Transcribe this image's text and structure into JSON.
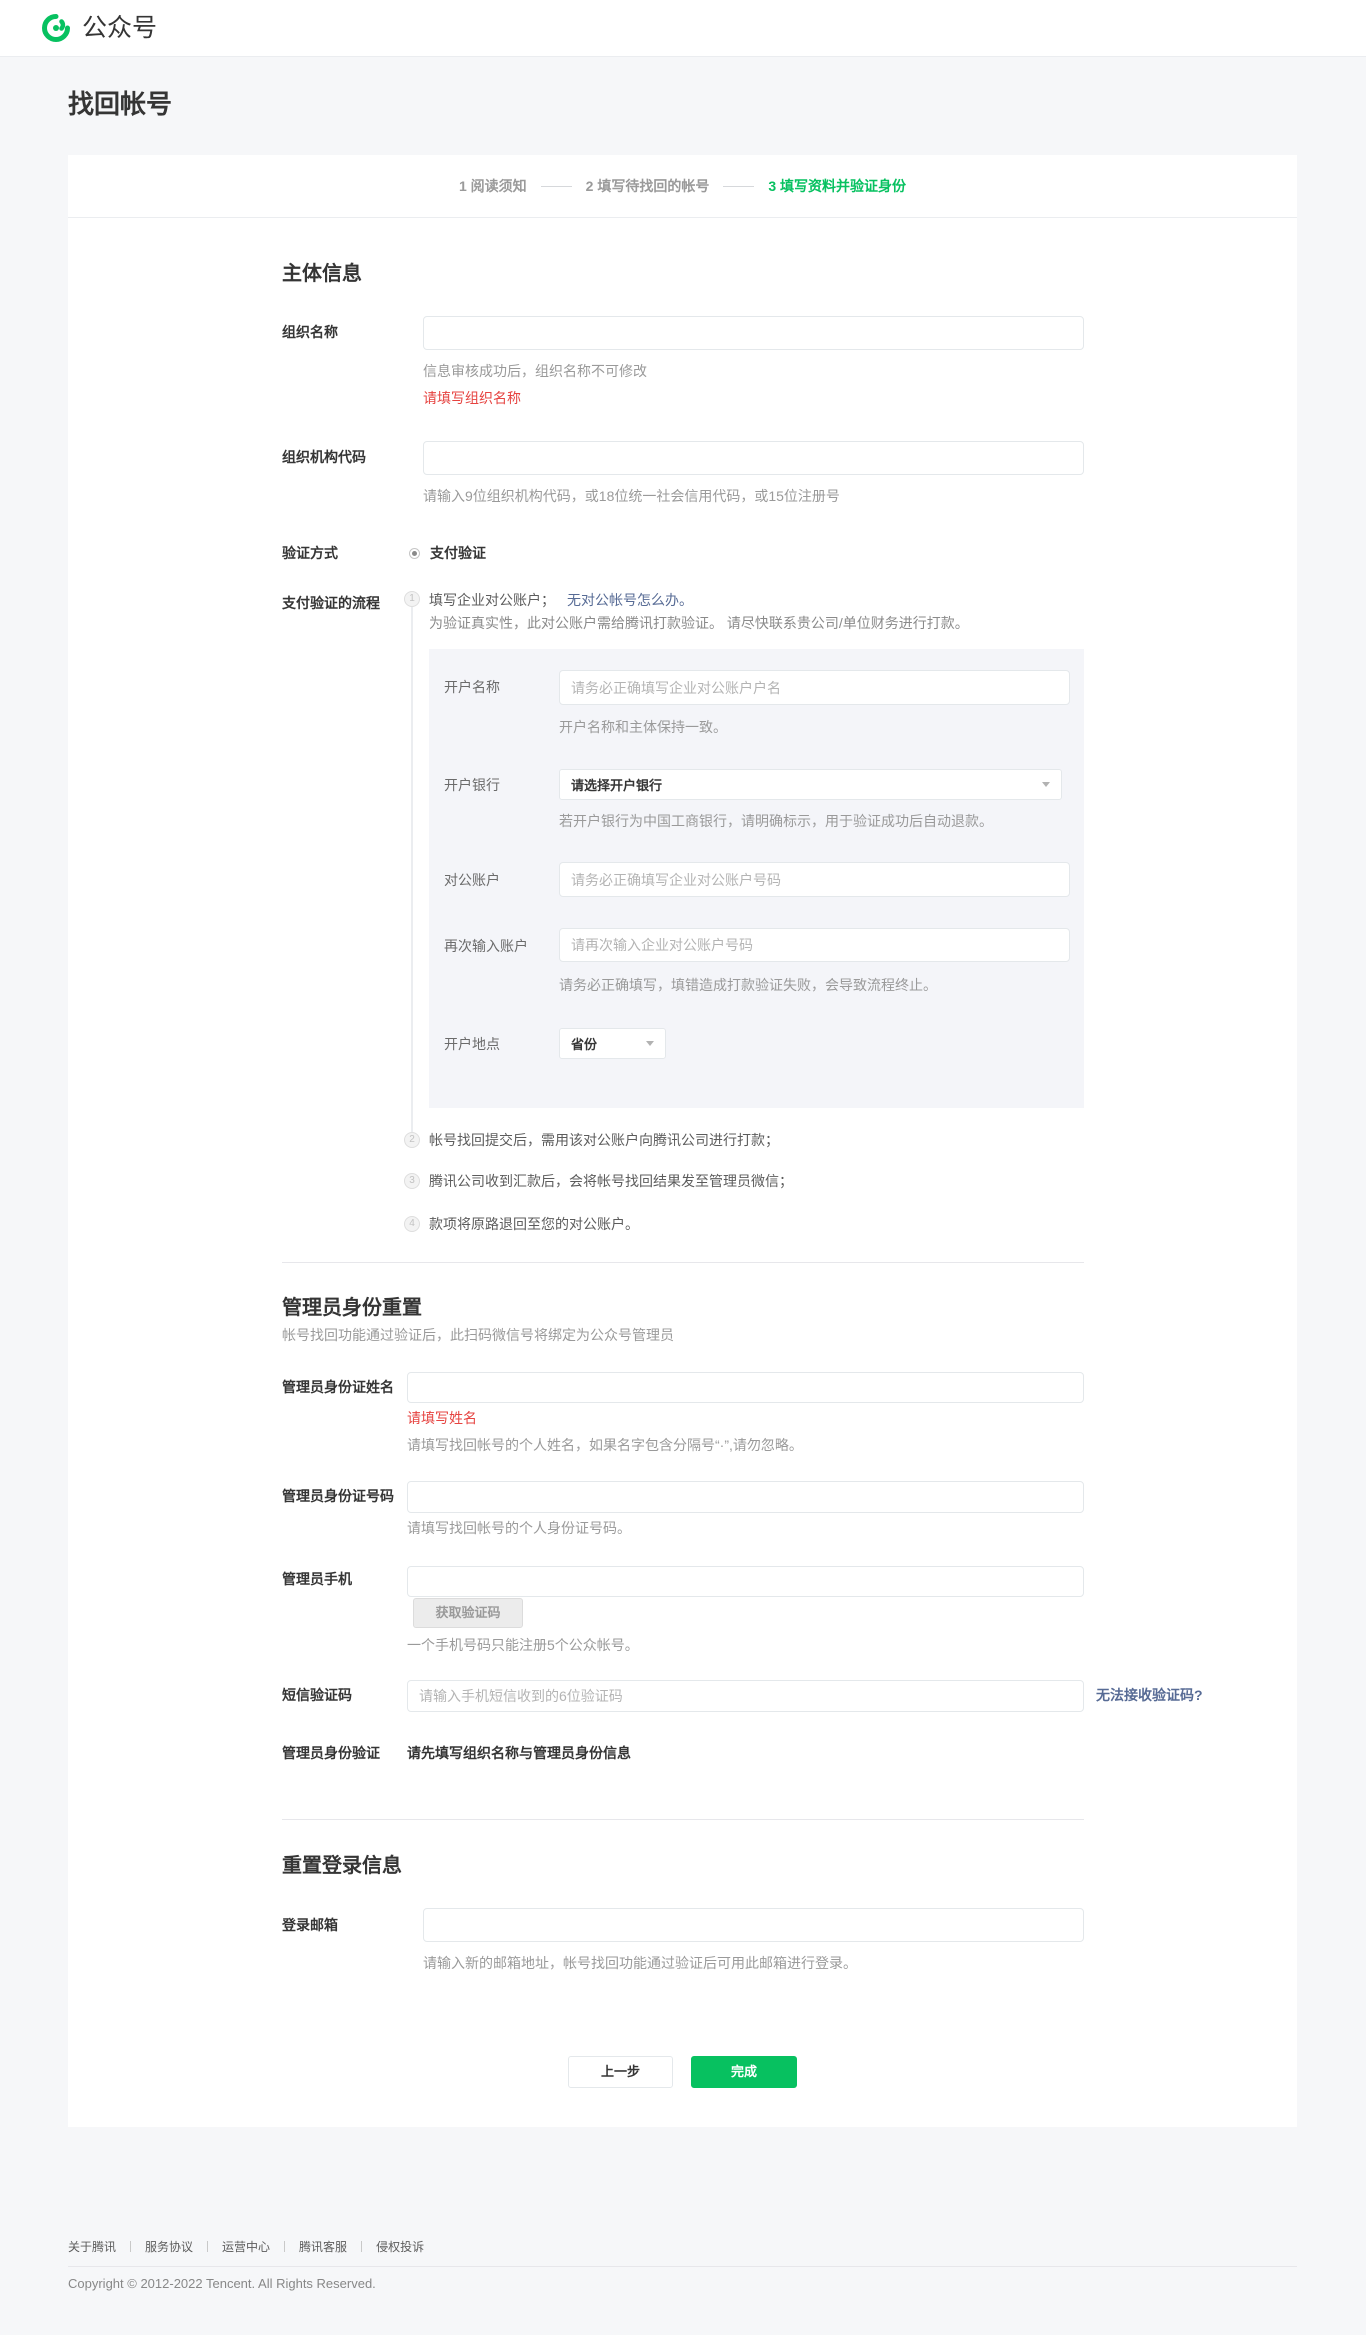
{
  "theme": {
    "accent": "#07c160",
    "link": "#576b95",
    "error": "#e64340"
  },
  "icons": {
    "logo": "official-account-logo-icon",
    "select_caret": "chevron-down-icon",
    "radio": "radio-selected-icon",
    "step_marker": "step-number-circle-icon"
  },
  "header": {
    "logo_text": "公众号"
  },
  "page_title": "找回帐号",
  "current_step": 3,
  "steps": [
    {
      "label": "1 阅读须知"
    },
    {
      "label": "2 填写待找回的帐号"
    },
    {
      "label": "3 填写资料并验证身份"
    }
  ],
  "subject": {
    "title": "主体信息",
    "org_name": {
      "label": "组织名称",
      "hint": "信息审核成功后，组织名称不可修改",
      "error": "请填写组织名称"
    },
    "org_code": {
      "label": "组织机构代码",
      "hint": "请输入9位组织机构代码，或18位统一社会信用代码，或15位注册号"
    },
    "verify_method": {
      "label": "验证方式",
      "option": "支付验证",
      "selected": true
    },
    "pay_flow": {
      "label": "支付验证的流程",
      "steps": [
        {
          "num": "1",
          "text": "填写企业对公账户；",
          "link": "无对公帐号怎么办。",
          "desc": "为验证真实性，此对公账户需给腾讯打款验证。 请尽快联系贵公司/单位财务进行打款。"
        },
        {
          "num": "2",
          "text": "帐号找回提交后，需用该对公账户向腾讯公司进行打款；"
        },
        {
          "num": "3",
          "text": "腾讯公司收到汇款后，会将帐号找回结果发至管理员微信；"
        },
        {
          "num": "4",
          "text": "款项将原路退回至您的对公账户。"
        }
      ],
      "bank_form": {
        "account_name": {
          "label": "开户名称",
          "placeholder": "请务必正确填写企业对公账户户名",
          "hint": "开户名称和主体保持一致。"
        },
        "bank": {
          "label": "开户银行",
          "selected": "请选择开户银行",
          "hint": "若开户银行为中国工商银行，请明确标示，用于验证成功后自动退款。"
        },
        "account_no": {
          "label": "对公账户",
          "placeholder": "请务必正确填写企业对公账户号码"
        },
        "account_no_confirm": {
          "label": "再次输入账户",
          "placeholder": "请再次输入企业对公账户号码",
          "hint": "请务必正确填写，填错造成打款验证失败，会导致流程终止。"
        },
        "location": {
          "label": "开户地点",
          "selected": "省份"
        }
      }
    }
  },
  "admin": {
    "title": "管理员身份重置",
    "subtitle": "帐号找回功能通过验证后，此扫码微信号将绑定为公众号管理员",
    "name": {
      "label": "管理员身份证姓名",
      "error": "请填写姓名",
      "hint": "请填写找回帐号的个人姓名，如果名字包含分隔号“·”,请勿忽略。"
    },
    "id_number": {
      "label": "管理员身份证号码",
      "hint": "请填写找回帐号的个人身份证号码。"
    },
    "phone": {
      "label": "管理员手机",
      "get_code_button": "获取验证码",
      "hint": "一个手机号码只能注册5个公众帐号。"
    },
    "sms_code": {
      "label": "短信验证码",
      "placeholder": "请输入手机短信收到的6位验证码",
      "help_link": "无法接收验证码?"
    },
    "identity_verify": {
      "label": "管理员身份验证",
      "status": "请先填写组织名称与管理员身份信息"
    }
  },
  "login": {
    "title": "重置登录信息",
    "email": {
      "label": "登录邮箱",
      "hint": "请输入新的邮箱地址，帐号找回功能通过验证后可用此邮箱进行登录。"
    }
  },
  "actions": {
    "prev": "上一步",
    "done": "完成"
  },
  "footer": {
    "links": [
      "关于腾讯",
      "服务协议",
      "运营中心",
      "腾讯客服",
      "侵权投诉"
    ],
    "copyright": "Copyright © 2012-2022 Tencent. All Rights Reserved."
  }
}
